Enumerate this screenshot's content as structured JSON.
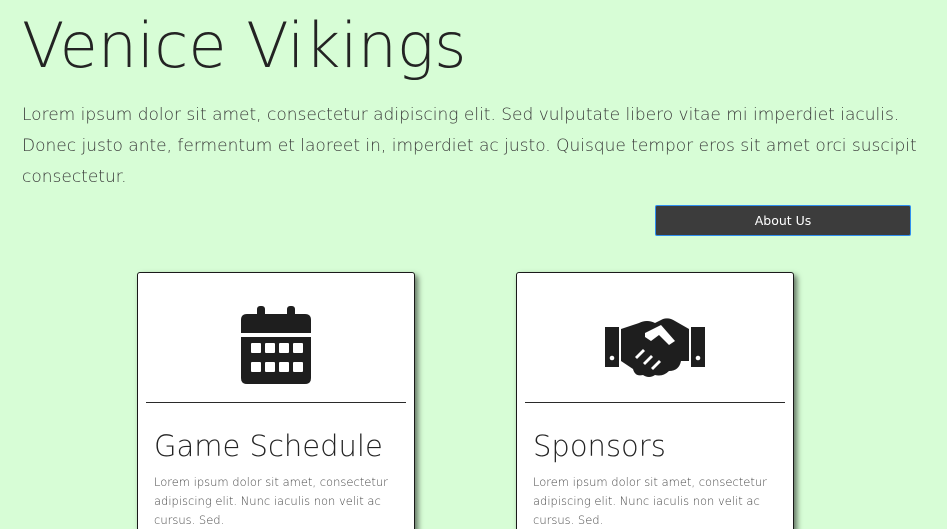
{
  "header": {
    "title": "Venice Vikings",
    "intro": "Lorem ipsum dolor sit amet, consectetur adipiscing elit. Sed vulputate libero vitae mi imperdiet iaculis. Donec justo ante, fermentum et laoreet in, imperdiet ac justo. Quisque tempor eros sit amet orci suscipit consectetur.",
    "about_button_label": "About Us"
  },
  "cards": [
    {
      "icon": "calendar-icon",
      "title": "Game Schedule",
      "text": "Lorem ipsum dolor sit amet, consectetur adipiscing elit. Nunc iaculis non velit ac cursus. Sed."
    },
    {
      "icon": "handshake-icon",
      "title": "Sponsors",
      "text": "Lorem ipsum dolor sit amet, consectetur adipiscing elit. Nunc iaculis non velit ac cursus. Sed."
    }
  ],
  "colors": {
    "background": "#d7fdd6",
    "button_bg": "#3c3c3c",
    "button_border": "#2f8ff0",
    "text": "#232323",
    "icon": "#1e1e1e"
  }
}
